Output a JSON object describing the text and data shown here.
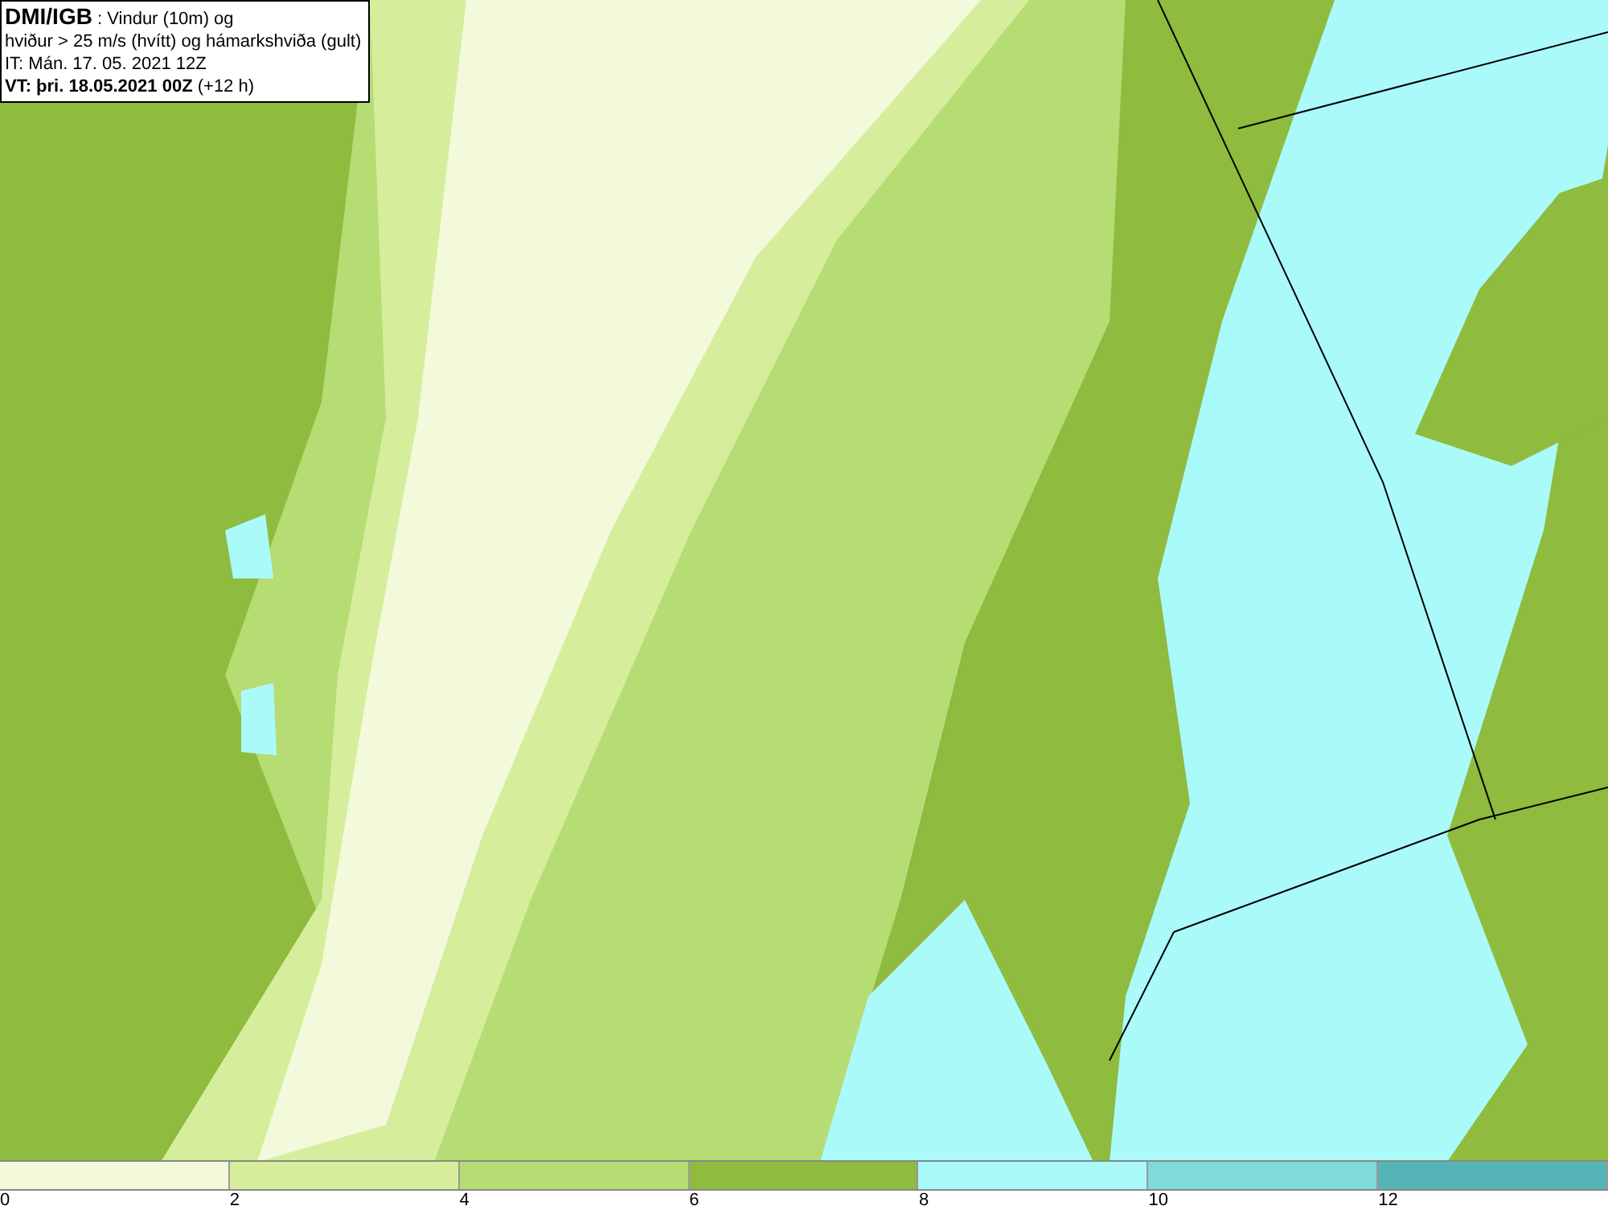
{
  "header": {
    "lines": [
      "**DMI/IGB** : Vindur (10m) og",
      "hviður > 25 m/s (hvítt) og hámarkshviða (gult)",
      "IT: Mán. 17. 05. 2021 12Z",
      "**VT: þri. 18.05.2021 00Z** (+12 h)"
    ]
  },
  "legend": {
    "bins": [
      {
        "label": "0",
        "color": "#f3fadc"
      },
      {
        "label": "2",
        "color": "#d6ee9c"
      },
      {
        "label": "4",
        "color": "#b6dc74"
      },
      {
        "label": "6",
        "color": "#8fbb3e"
      },
      {
        "label": "8",
        "color": "#aafafa"
      },
      {
        "label": "10",
        "color": "#7fdada"
      },
      {
        "label": "12",
        "color": "#56b4b6"
      }
    ]
  }
}
